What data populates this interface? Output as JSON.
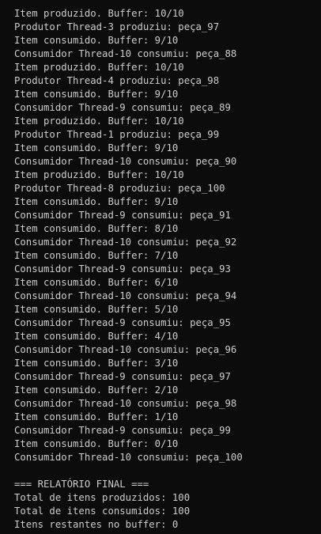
{
  "console": {
    "lines": [
      "Item produzido. Buffer: 10/10",
      "Produtor Thread-3 produziu: peça_97",
      "Item consumido. Buffer: 9/10",
      "Consumidor Thread-10 consumiu: peça_88",
      "Item produzido. Buffer: 10/10",
      "Produtor Thread-4 produziu: peça_98",
      "Item consumido. Buffer: 9/10",
      "Consumidor Thread-9 consumiu: peça_89",
      "Item produzido. Buffer: 10/10",
      "Produtor Thread-1 produziu: peça_99",
      "Item consumido. Buffer: 9/10",
      "Consumidor Thread-10 consumiu: peça_90",
      "Item produzido. Buffer: 10/10",
      "Produtor Thread-8 produziu: peça_100",
      "Item consumido. Buffer: 9/10",
      "Consumidor Thread-9 consumiu: peça_91",
      "Item consumido. Buffer: 8/10",
      "Consumidor Thread-10 consumiu: peça_92",
      "Item consumido. Buffer: 7/10",
      "Consumidor Thread-9 consumiu: peça_93",
      "Item consumido. Buffer: 6/10",
      "Consumidor Thread-10 consumiu: peça_94",
      "Item consumido. Buffer: 5/10",
      "Consumidor Thread-9 consumiu: peça_95",
      "Item consumido. Buffer: 4/10",
      "Consumidor Thread-10 consumiu: peça_96",
      "Item consumido. Buffer: 3/10",
      "Consumidor Thread-9 consumiu: peça_97",
      "Item consumido. Buffer: 2/10",
      "Consumidor Thread-10 consumiu: peça_98",
      "Item consumido. Buffer: 1/10",
      "Consumidor Thread-9 consumiu: peça_99",
      "Item consumido. Buffer: 0/10",
      "Consumidor Thread-10 consumiu: peça_100",
      "",
      "=== RELATÓRIO FINAL ===",
      "Total de itens produzidos: 100",
      "Total de itens consumidos: 100",
      "Itens restantes no buffer: 0"
    ]
  },
  "colors": {
    "background": "#0c0c0c",
    "text": "#cccccc"
  }
}
